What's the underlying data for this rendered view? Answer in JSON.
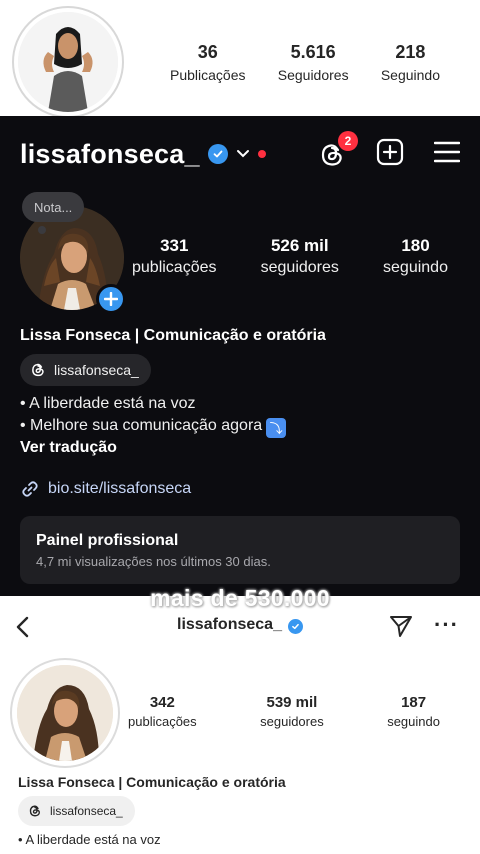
{
  "top_profile": {
    "stats": [
      {
        "value": "36",
        "label": "Publicações"
      },
      {
        "value": "5.616",
        "label": "Seguidores"
      },
      {
        "value": "218",
        "label": "Seguindo"
      }
    ]
  },
  "dark_profile": {
    "username": "lissafonseca_",
    "threads_badge": "2",
    "note_label": "Nota...",
    "stats": [
      {
        "value": "331",
        "label": "publicações"
      },
      {
        "value": "526 mil",
        "label": "seguidores"
      },
      {
        "value": "180",
        "label": "seguindo"
      }
    ],
    "full_name": "Lissa Fonseca | Comunicação e oratória",
    "threads_handle": "lissafonseca_",
    "bio_lines": [
      "• A liberdade está na voz",
      "• Melhore sua comunicação agora"
    ],
    "translate_label": "Ver tradução",
    "link": "bio.site/lissafonseca",
    "panel": {
      "title": "Painel profissional",
      "subtitle": "4,7 mi visualizações nos últimos 30 dias."
    }
  },
  "overlay_caption": "mais de 530.000",
  "bottom_profile": {
    "username": "lissafonseca_",
    "stats": [
      {
        "value": "342",
        "label": "publicações"
      },
      {
        "value": "539 mil",
        "label": "seguidores"
      },
      {
        "value": "187",
        "label": "seguindo"
      }
    ],
    "full_name": "Lissa Fonseca | Comunicação e oratória",
    "threads_handle": "lissafonseca_",
    "bio_line": "• A liberdade está na voz"
  },
  "icons": {
    "verified": "verified-badge-icon",
    "threads": "threads-icon",
    "add": "add-post-icon",
    "menu": "hamburger-menu-icon",
    "link": "link-icon",
    "back": "back-arrow-icon",
    "send": "send-icon",
    "more": "more-options-icon"
  },
  "colors": {
    "dark_bg": "#0c0c10",
    "verified_blue": "#3897f0",
    "notification_red": "#ff3040",
    "panel_bg": "#1f1f23"
  }
}
